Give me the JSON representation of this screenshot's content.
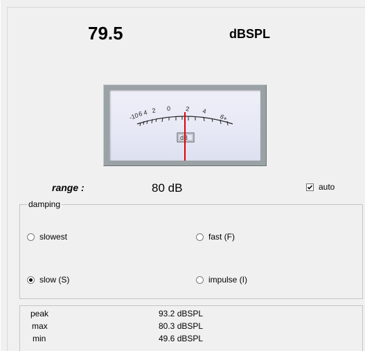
{
  "reading": {
    "value": "79.5",
    "unit": "dBSPL"
  },
  "meter": {
    "scale_labels": [
      "-10",
      "6",
      "4",
      "2",
      "0",
      "2",
      "4",
      "6+"
    ],
    "unit_label": "dB",
    "needle_color": "#e00000",
    "needle_level": 0.5
  },
  "range": {
    "label": "range :",
    "value": "80 dB"
  },
  "auto": {
    "label": "auto",
    "checked": true
  },
  "damping": {
    "title": "damping",
    "options": [
      {
        "label": "slowest",
        "checked": false
      },
      {
        "label": "fast (F)",
        "checked": false
      },
      {
        "label": "slow (S)",
        "checked": true
      },
      {
        "label": "impulse (I)",
        "checked": false
      }
    ]
  },
  "stats": [
    {
      "label": "peak",
      "value": "93.2 dBSPL"
    },
    {
      "label": "max",
      "value": "80.3 dBSPL"
    },
    {
      "label": "min",
      "value": "49.6 dBSPL"
    }
  ]
}
